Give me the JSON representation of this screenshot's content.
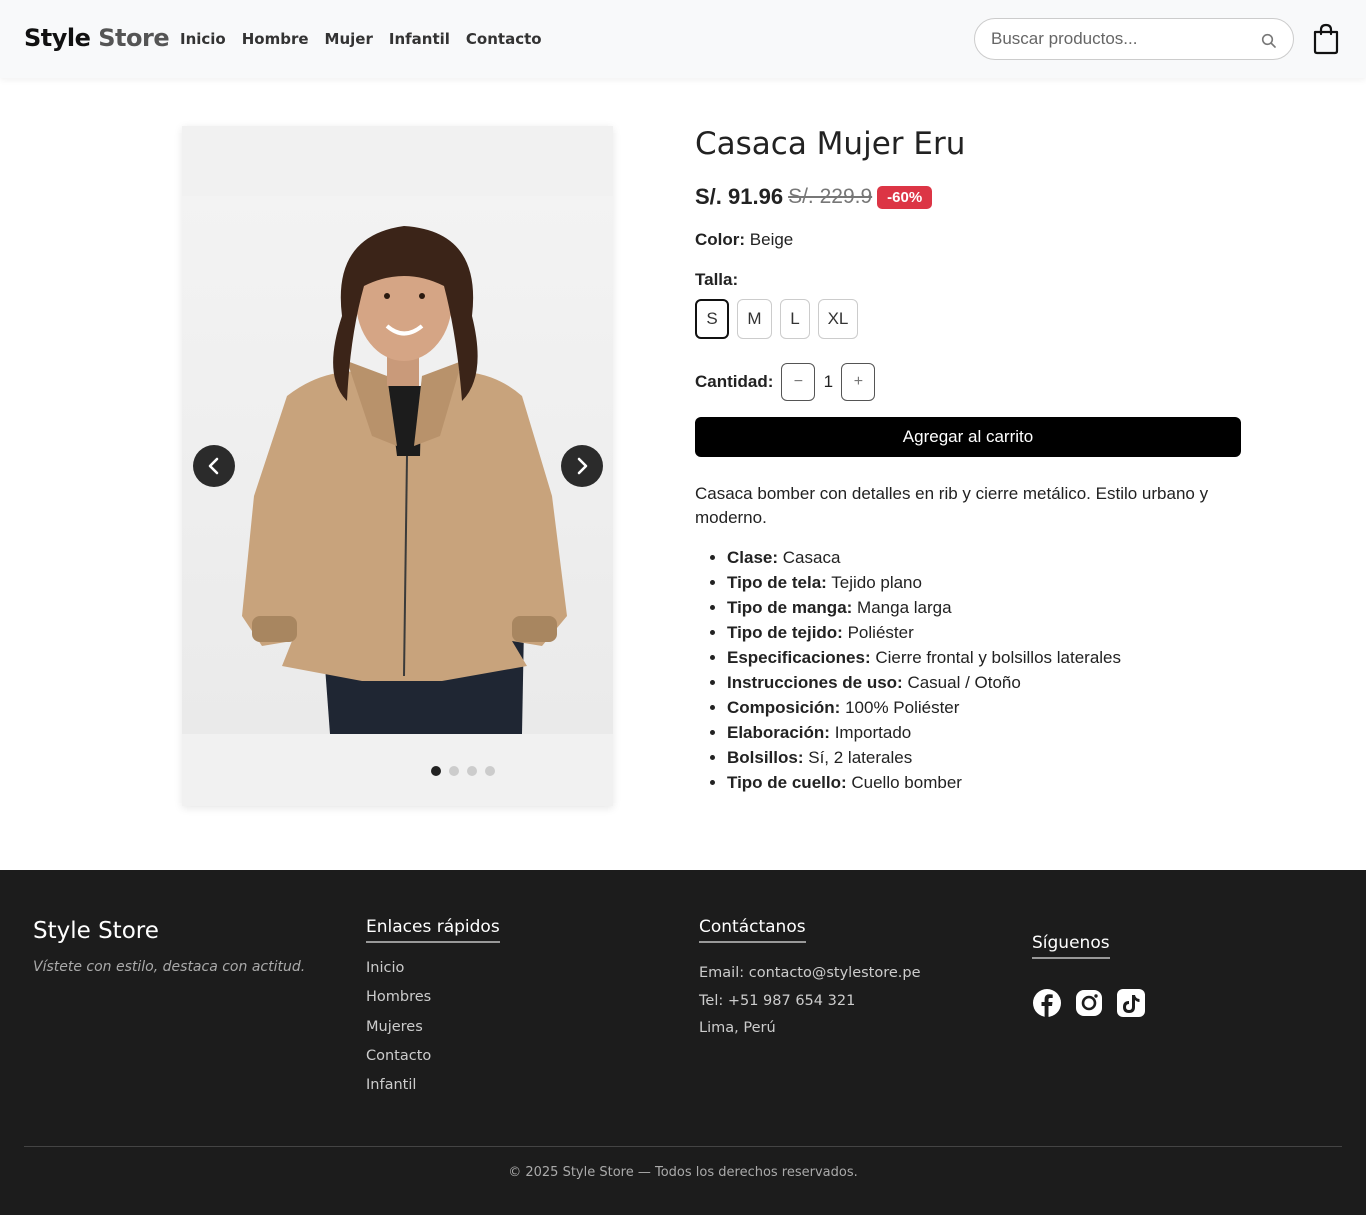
{
  "header": {
    "logo_part1": "Style",
    "logo_part2": "Store",
    "nav": [
      "Inicio",
      "Hombre",
      "Mujer",
      "Infantil",
      "Contacto"
    ],
    "search_placeholder": "Buscar productos...",
    "icons": [
      "search-icon",
      "shopping-bag-icon"
    ]
  },
  "gallery": {
    "image_count": 4,
    "active_index": 0,
    "icons": [
      "chevron-left-icon",
      "chevron-right-icon"
    ]
  },
  "product": {
    "title": "Casaca Mujer Eru",
    "price": "S/. 91.96",
    "old_price": "S/. 229.9",
    "discount": "-60%",
    "color_label": "Color:",
    "color_value": "Beige",
    "size_label": "Talla:",
    "sizes": [
      "S",
      "M",
      "L",
      "XL"
    ],
    "selected_size": "S",
    "qty_label": "Cantidad:",
    "qty_minus": "−",
    "qty_value": "1",
    "qty_plus": "+",
    "cart_button": "Agregar al carrito",
    "description": "Casaca bomber con detalles en rib y cierre metálico. Estilo urbano y moderno.",
    "specs": [
      {
        "k": "Clase:",
        "v": "Casaca"
      },
      {
        "k": "Tipo de tela:",
        "v": "Tejido plano"
      },
      {
        "k": "Tipo de manga:",
        "v": "Manga larga"
      },
      {
        "k": "Tipo de tejido:",
        "v": "Poliéster"
      },
      {
        "k": "Especificaciones:",
        "v": "Cierre frontal y bolsillos laterales"
      },
      {
        "k": "Instrucciones de uso:",
        "v": "Casual / Otoño"
      },
      {
        "k": "Composición:",
        "v": "100% Poliéster"
      },
      {
        "k": "Elaboración:",
        "v": "Importado"
      },
      {
        "k": "Bolsillos:",
        "v": "Sí, 2 laterales"
      },
      {
        "k": "Tipo de cuello:",
        "v": "Cuello bomber"
      }
    ]
  },
  "footer": {
    "brand": "Style Store",
    "tagline": "Vístete con estilo, destaca con actitud.",
    "links_title": "Enlaces rápidos",
    "links": [
      "Inicio",
      "Hombres",
      "Mujeres",
      "Contacto",
      "Infantil"
    ],
    "contact_title": "Contáctanos",
    "contact": [
      "Email: contacto@stylestore.pe",
      "Tel: +51 987 654 321",
      "Lima, Perú"
    ],
    "social_title": "Síguenos",
    "social_icons": [
      "facebook-icon",
      "instagram-icon",
      "tiktok-icon"
    ],
    "copyright": "© 2025 Style Store — Todos los derechos reservados."
  },
  "colors": {
    "header_bg": "#f8f9fa",
    "discount_badge": "#dc3545",
    "cart_button": "#000000",
    "footer_bg": "#1c1c1c",
    "jacket": "#c8a37c"
  }
}
